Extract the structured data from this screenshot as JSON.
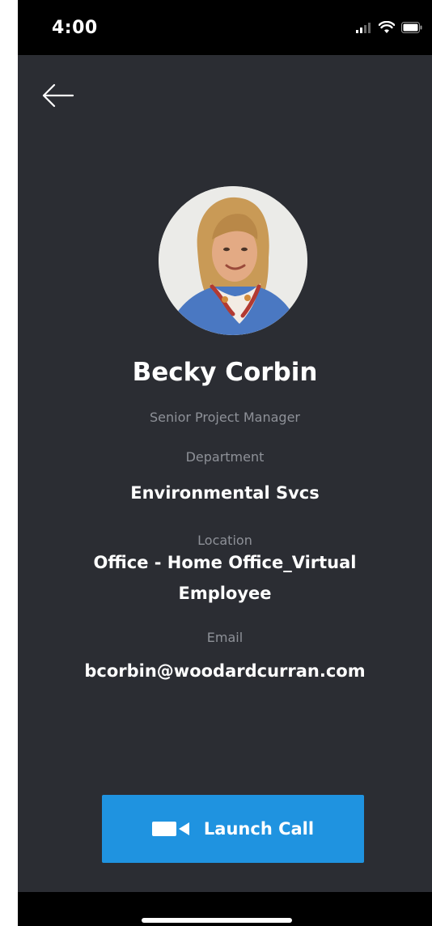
{
  "status_bar": {
    "time": "4:00"
  },
  "profile": {
    "name": "Becky Corbin",
    "title": "Senior Project Manager",
    "department_label": "Department",
    "department": "Environmental Svcs",
    "location_label": "Location",
    "location_line1": "Office - Home Office_Virtual",
    "location_line2": "Employee",
    "email_label": "Email",
    "email": "bcorbin@woodardcurran.com"
  },
  "actions": {
    "launch_call_label": "Launch Call"
  },
  "icons": {
    "back": "arrow-left-icon",
    "call": "video-camera-icon",
    "signal": "cellular-signal-icon",
    "wifi": "wifi-icon",
    "battery": "battery-icon"
  },
  "colors": {
    "background": "#2b2d33",
    "accent": "#1f93e0",
    "muted_text": "#8e9198"
  }
}
